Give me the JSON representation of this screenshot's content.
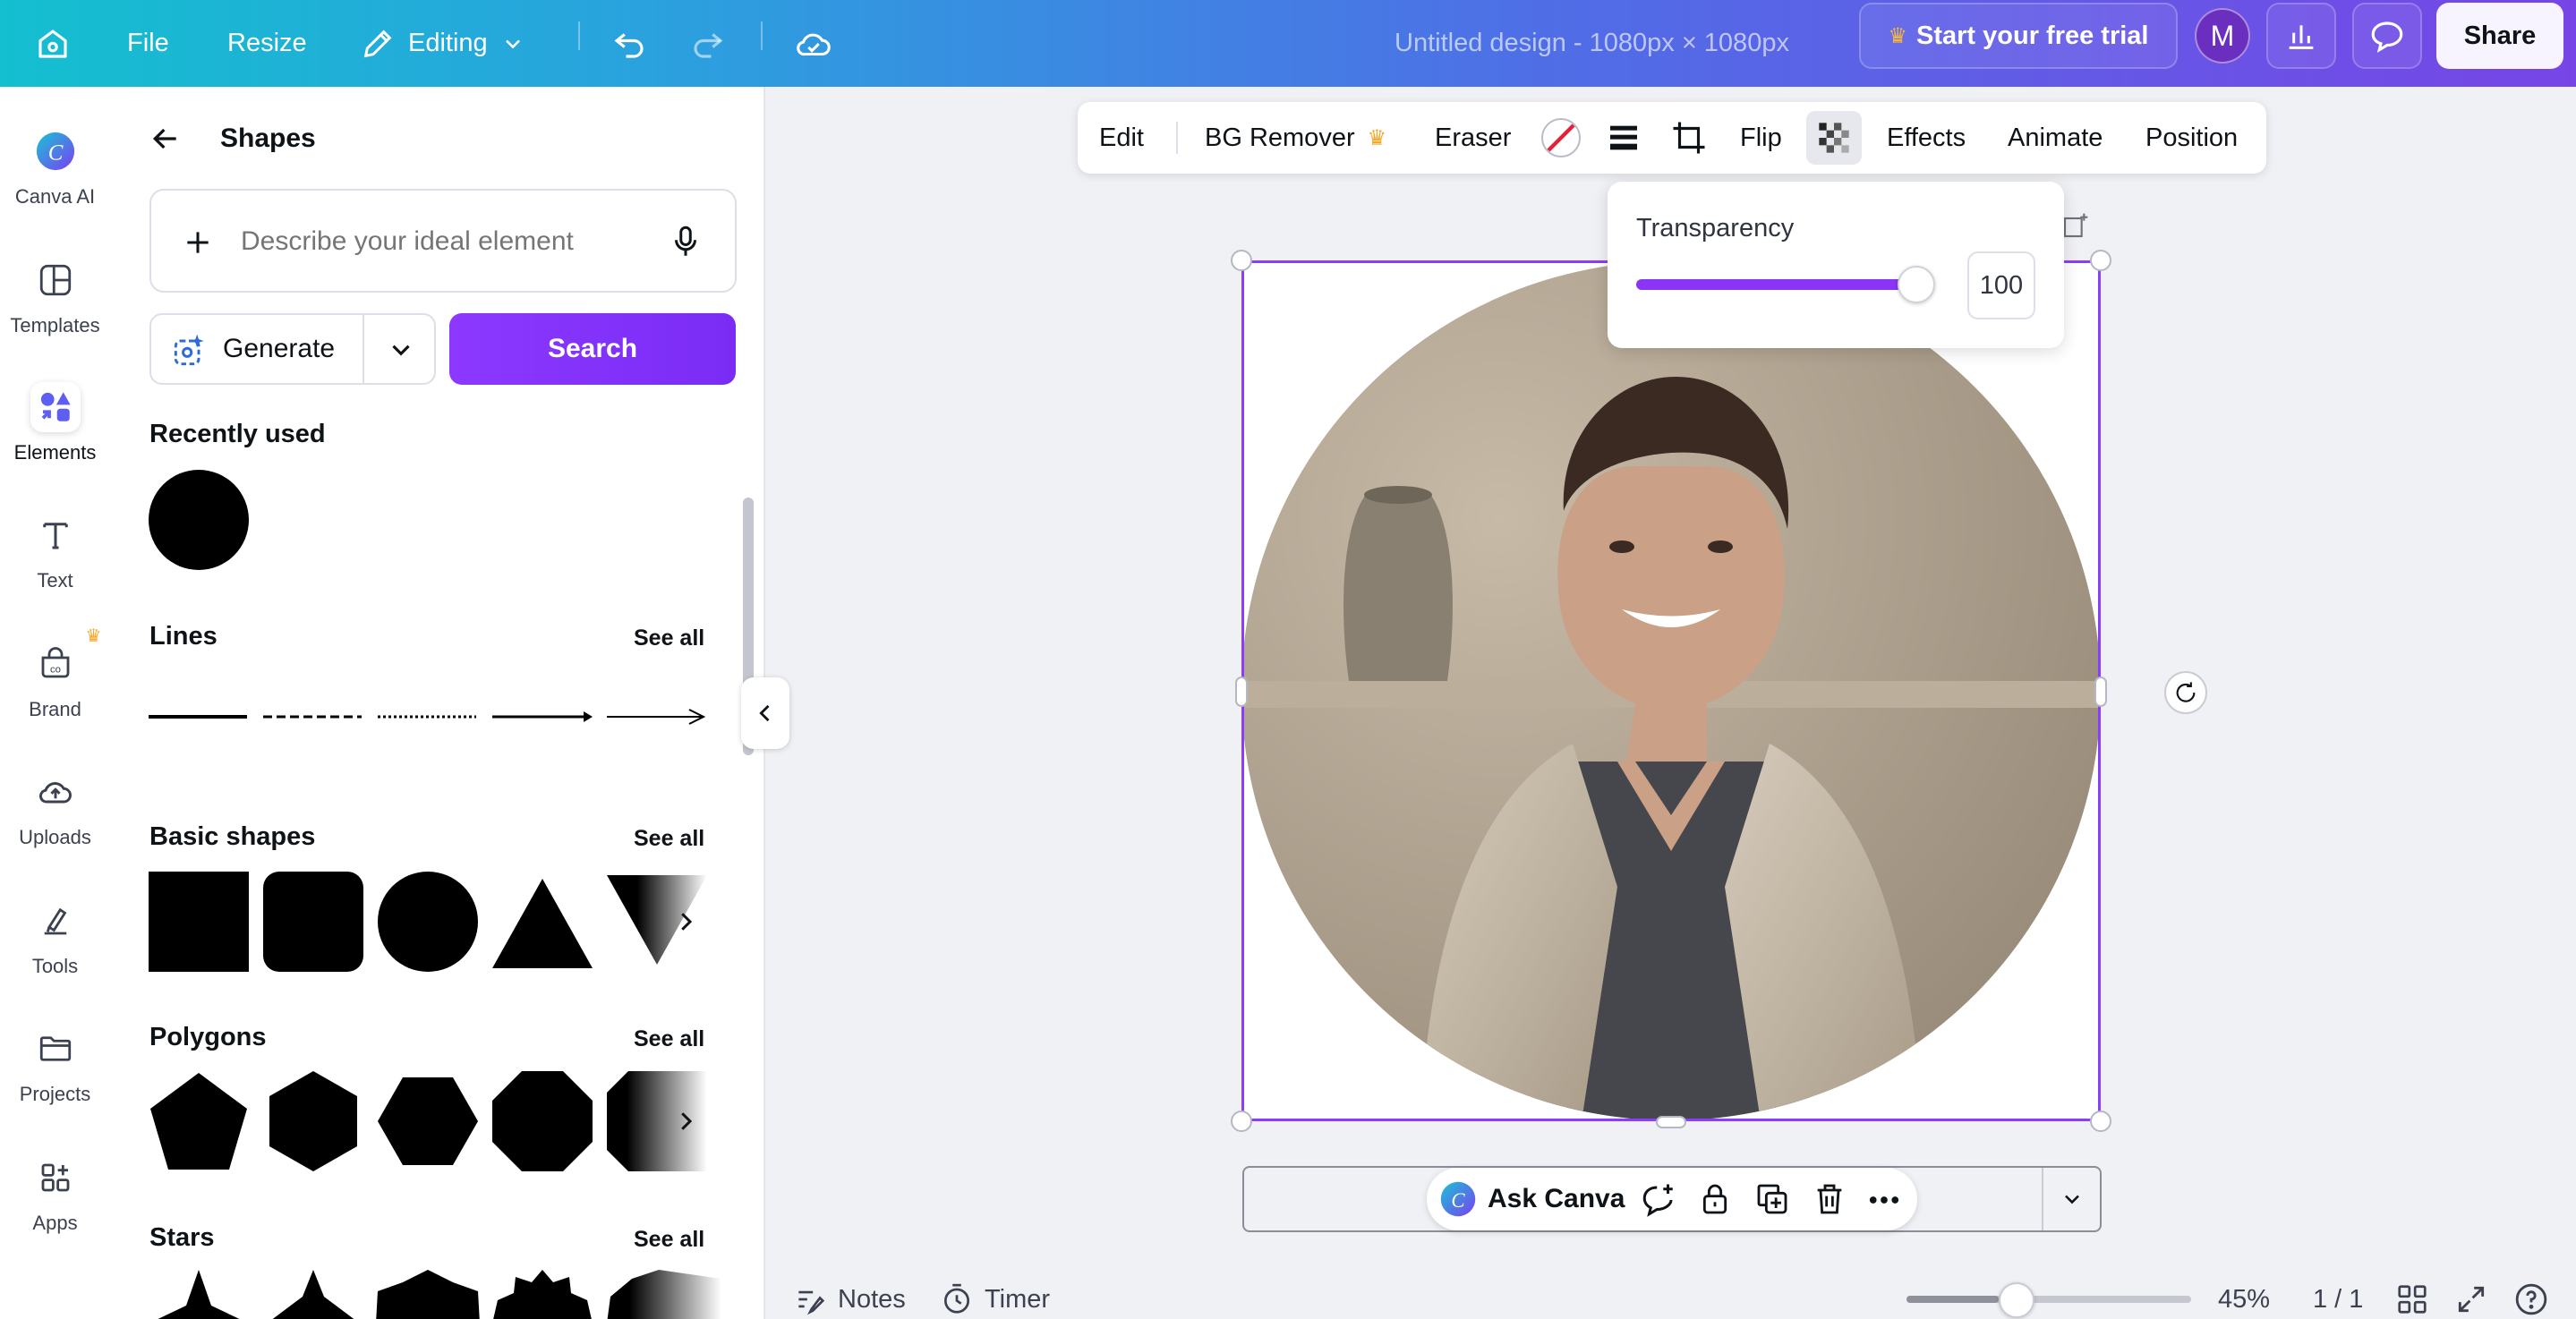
{
  "topbar": {
    "file": "File",
    "resize": "Resize",
    "editing": "Editing",
    "design_title": "Untitled design - 1080px × 1080px",
    "trial": "Start your free trial",
    "avatar_initial": "M",
    "share": "Share"
  },
  "rail": [
    {
      "label": "Canva AI",
      "icon": "canva-ai-icon"
    },
    {
      "label": "Templates",
      "icon": "templates-icon"
    },
    {
      "label": "Elements",
      "icon": "elements-icon",
      "active": true
    },
    {
      "label": "Text",
      "icon": "text-icon"
    },
    {
      "label": "Brand",
      "icon": "brand-icon"
    },
    {
      "label": "Uploads",
      "icon": "uploads-icon"
    },
    {
      "label": "Tools",
      "icon": "tools-icon"
    },
    {
      "label": "Projects",
      "icon": "projects-icon"
    },
    {
      "label": "Apps",
      "icon": "apps-icon"
    }
  ],
  "panel": {
    "title": "Shapes",
    "search_placeholder": "Describe your ideal element",
    "generate": "Generate",
    "search": "Search",
    "recently_used": "Recently used",
    "sections": [
      {
        "title": "Lines",
        "see_all": "See all"
      },
      {
        "title": "Basic shapes",
        "see_all": "See all"
      },
      {
        "title": "Polygons",
        "see_all": "See all"
      },
      {
        "title": "Stars",
        "see_all": "See all"
      }
    ]
  },
  "toolbar": {
    "edit": "Edit",
    "bg_remover": "BG Remover",
    "eraser": "Eraser",
    "flip": "Flip",
    "effects": "Effects",
    "animate": "Animate",
    "position": "Position"
  },
  "transparency": {
    "label": "Transparency",
    "value": "100",
    "level_percent": 100
  },
  "ask": {
    "label": "Ask Canva"
  },
  "footer": {
    "notes": "Notes",
    "timer": "Timer",
    "zoom": "45%",
    "pages": "1 / 1"
  },
  "colors": {
    "accent": "#8b3dff",
    "crown": "#f5a623"
  }
}
